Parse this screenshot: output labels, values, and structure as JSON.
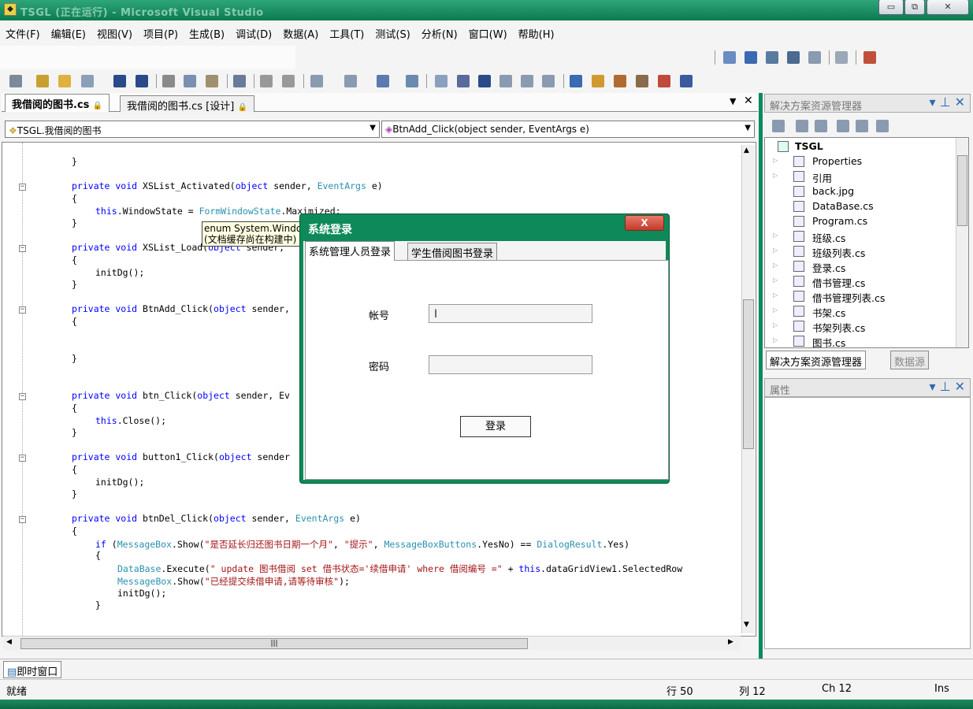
{
  "window": {
    "title": "TSGL (正在运行) - Microsoft Visual Studio"
  },
  "menu": [
    "文件(F)",
    "编辑(E)",
    "视图(V)",
    "项目(P)",
    "生成(B)",
    "调试(D)",
    "数据(A)",
    "工具(T)",
    "测试(S)",
    "分析(N)",
    "窗口(W)",
    "帮助(H)"
  ],
  "doc_tabs": [
    "我借阅的图书.cs",
    "我借阅的图书.cs [设计]"
  ],
  "nav": {
    "class_combo": "TSGL.我借阅的图书",
    "member_combo": "BtnAdd_Click(object sender, EventArgs e)"
  },
  "code": {
    "l1": "}",
    "l2a": "private void ",
    "l2b": "XSList_Activated(",
    "l2c": "object",
    "l2d": " sender, ",
    "l2e": "EventArgs",
    "l2f": " e)",
    "l3": "{",
    "l4a": "this",
    "l4b": ".WindowState = ",
    "l4c": "FormWindowState",
    "l4d": ".Maximized;",
    "l5": "}",
    "l6a": "private void ",
    "l6b": "XSList_Load(",
    "l6c": "object",
    "l6d": " sender, ",
    "l7": "{",
    "l8": "initDg();",
    "l9": "}",
    "l10a": "private void ",
    "l10b": "BtnAdd_Click(",
    "l10c": "object",
    "l10d": " sender,",
    "l11": "{",
    "l12": "}",
    "l13a": "private void ",
    "l13b": "btn_Click(",
    "l13c": "object",
    "l13d": " sender, Ev",
    "l14": "{",
    "l15a": "this",
    "l15b": ".Close();",
    "l16": "}",
    "l17a": "private void ",
    "l17b": "button1_Click(",
    "l17c": "object",
    "l17d": " sender",
    "l18": "{",
    "l19": "initDg();",
    "l20": "}",
    "l21a": "private void ",
    "l21b": "btnDel_Click(",
    "l21c": "object",
    "l21d": " sender, ",
    "l21e": "EventArgs",
    "l21f": " e)",
    "l22": "{",
    "l23a": "if",
    "l23b": " (",
    "l23c": "MessageBox",
    "l23d": ".Show(",
    "l23e": "\"是否延长归还图书日期一个月\"",
    "l23f": ", ",
    "l23g": "\"提示\"",
    "l23h": ", ",
    "l23i": "MessageBoxButtons",
    "l23j": ".YesNo) == ",
    "l23k": "DialogResult",
    "l23l": ".Yes)",
    "l24": "{",
    "l25a": "DataBase",
    "l25b": ".Execute(",
    "l25c": "\" update 图书借阅 set 借书状态='续借申请' where 借阅编号 =\"",
    "l25d": " + ",
    "l25e": "this",
    "l25f": ".dataGridView1.SelectedRow",
    "l26a": "MessageBox",
    "l26b": ".Show(",
    "l26c": "\"已经提交续借申请,请等待审核\"",
    "l26d": ");",
    "l27": "initDg();",
    "l28": "}"
  },
  "tooltip": {
    "line1": "enum System.Windows.Forms.FormWindowState",
    "line2": "(文档缓存尚在构建中)"
  },
  "solution_explorer": {
    "title": "解决方案资源管理器",
    "root": "TSGL",
    "items": [
      "Properties",
      "引用",
      "back.jpg",
      "DataBase.cs",
      "Program.cs",
      "班级.cs",
      "班级列表.cs",
      "登录.cs",
      "借书管理.cs",
      "借书管理列表.cs",
      "书架.cs",
      "书架列表.cs",
      "图书.cs"
    ]
  },
  "panel_tabs": [
    "解决方案资源管理器",
    "数据源"
  ],
  "properties": {
    "title": "属性"
  },
  "immediate": {
    "label": "即时窗口"
  },
  "status": {
    "ready": "就绪",
    "line": "行 50",
    "col": "列 12",
    "ch": "Ch 12",
    "ins": "Ins"
  },
  "dialog": {
    "title": "系统登录",
    "close": "X",
    "tabs": [
      "系统管理人员登录",
      "学生借阅图书登录"
    ],
    "account_label": "帐号",
    "password_label": "密码",
    "account_value": "",
    "password_value": "",
    "login_button": "登录"
  },
  "colors": {
    "keyword": "#0000ff",
    "type": "#2b91af",
    "string": "#a31515",
    "chrome_green": "#0e8a5a"
  }
}
